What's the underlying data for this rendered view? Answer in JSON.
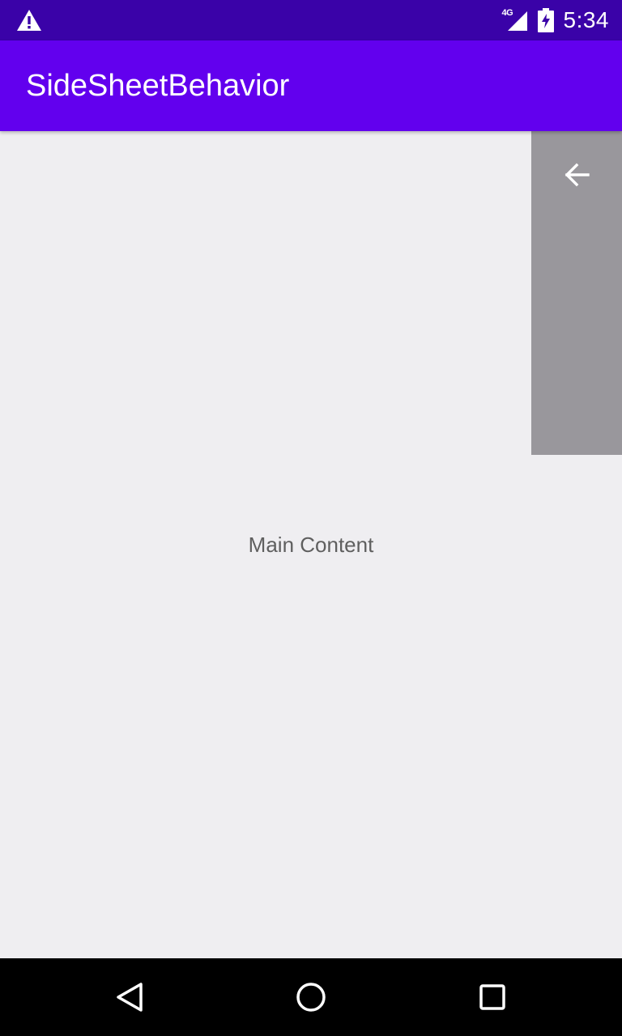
{
  "status_bar": {
    "network_label": "4G",
    "time": "5:34",
    "icons": [
      "warning-icon",
      "signal-icon",
      "battery-charging-icon"
    ]
  },
  "app_bar": {
    "title": "SideSheetBehavior"
  },
  "main": {
    "content_label": "Main Content"
  },
  "side_sheet": {
    "icon": "arrow-back-icon"
  },
  "nav_bar": {
    "icons": [
      "nav-back-icon",
      "nav-home-icon",
      "nav-recents-icon"
    ]
  },
  "colors": {
    "status_bar": "#3a02a8",
    "app_bar": "#6200ee",
    "background": "#efeef1",
    "side_sheet": "#99979c",
    "nav_bar": "#000000"
  }
}
